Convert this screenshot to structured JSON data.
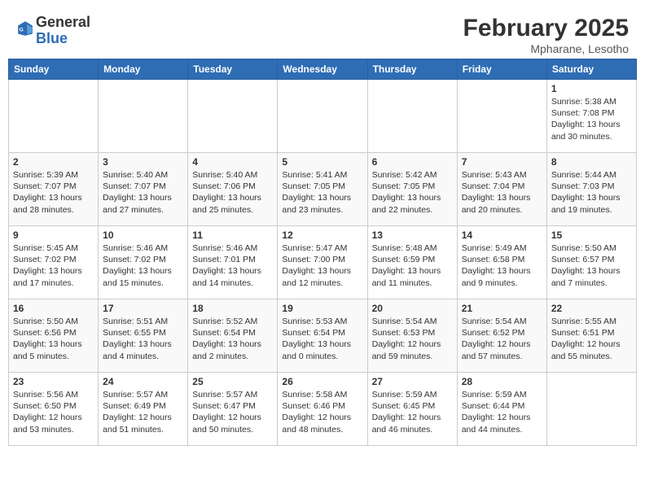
{
  "header": {
    "logo_general": "General",
    "logo_blue": "Blue",
    "month_year": "February 2025",
    "location": "Mpharane, Lesotho"
  },
  "days_of_week": [
    "Sunday",
    "Monday",
    "Tuesday",
    "Wednesday",
    "Thursday",
    "Friday",
    "Saturday"
  ],
  "weeks": [
    [
      {
        "day": "",
        "info": ""
      },
      {
        "day": "",
        "info": ""
      },
      {
        "day": "",
        "info": ""
      },
      {
        "day": "",
        "info": ""
      },
      {
        "day": "",
        "info": ""
      },
      {
        "day": "",
        "info": ""
      },
      {
        "day": "1",
        "info": "Sunrise: 5:38 AM\nSunset: 7:08 PM\nDaylight: 13 hours\nand 30 minutes."
      }
    ],
    [
      {
        "day": "2",
        "info": "Sunrise: 5:39 AM\nSunset: 7:07 PM\nDaylight: 13 hours\nand 28 minutes."
      },
      {
        "day": "3",
        "info": "Sunrise: 5:40 AM\nSunset: 7:07 PM\nDaylight: 13 hours\nand 27 minutes."
      },
      {
        "day": "4",
        "info": "Sunrise: 5:40 AM\nSunset: 7:06 PM\nDaylight: 13 hours\nand 25 minutes."
      },
      {
        "day": "5",
        "info": "Sunrise: 5:41 AM\nSunset: 7:05 PM\nDaylight: 13 hours\nand 23 minutes."
      },
      {
        "day": "6",
        "info": "Sunrise: 5:42 AM\nSunset: 7:05 PM\nDaylight: 13 hours\nand 22 minutes."
      },
      {
        "day": "7",
        "info": "Sunrise: 5:43 AM\nSunset: 7:04 PM\nDaylight: 13 hours\nand 20 minutes."
      },
      {
        "day": "8",
        "info": "Sunrise: 5:44 AM\nSunset: 7:03 PM\nDaylight: 13 hours\nand 19 minutes."
      }
    ],
    [
      {
        "day": "9",
        "info": "Sunrise: 5:45 AM\nSunset: 7:02 PM\nDaylight: 13 hours\nand 17 minutes."
      },
      {
        "day": "10",
        "info": "Sunrise: 5:46 AM\nSunset: 7:02 PM\nDaylight: 13 hours\nand 15 minutes."
      },
      {
        "day": "11",
        "info": "Sunrise: 5:46 AM\nSunset: 7:01 PM\nDaylight: 13 hours\nand 14 minutes."
      },
      {
        "day": "12",
        "info": "Sunrise: 5:47 AM\nSunset: 7:00 PM\nDaylight: 13 hours\nand 12 minutes."
      },
      {
        "day": "13",
        "info": "Sunrise: 5:48 AM\nSunset: 6:59 PM\nDaylight: 13 hours\nand 11 minutes."
      },
      {
        "day": "14",
        "info": "Sunrise: 5:49 AM\nSunset: 6:58 PM\nDaylight: 13 hours\nand 9 minutes."
      },
      {
        "day": "15",
        "info": "Sunrise: 5:50 AM\nSunset: 6:57 PM\nDaylight: 13 hours\nand 7 minutes."
      }
    ],
    [
      {
        "day": "16",
        "info": "Sunrise: 5:50 AM\nSunset: 6:56 PM\nDaylight: 13 hours\nand 5 minutes."
      },
      {
        "day": "17",
        "info": "Sunrise: 5:51 AM\nSunset: 6:55 PM\nDaylight: 13 hours\nand 4 minutes."
      },
      {
        "day": "18",
        "info": "Sunrise: 5:52 AM\nSunset: 6:54 PM\nDaylight: 13 hours\nand 2 minutes."
      },
      {
        "day": "19",
        "info": "Sunrise: 5:53 AM\nSunset: 6:54 PM\nDaylight: 13 hours\nand 0 minutes."
      },
      {
        "day": "20",
        "info": "Sunrise: 5:54 AM\nSunset: 6:53 PM\nDaylight: 12 hours\nand 59 minutes."
      },
      {
        "day": "21",
        "info": "Sunrise: 5:54 AM\nSunset: 6:52 PM\nDaylight: 12 hours\nand 57 minutes."
      },
      {
        "day": "22",
        "info": "Sunrise: 5:55 AM\nSunset: 6:51 PM\nDaylight: 12 hours\nand 55 minutes."
      }
    ],
    [
      {
        "day": "23",
        "info": "Sunrise: 5:56 AM\nSunset: 6:50 PM\nDaylight: 12 hours\nand 53 minutes."
      },
      {
        "day": "24",
        "info": "Sunrise: 5:57 AM\nSunset: 6:49 PM\nDaylight: 12 hours\nand 51 minutes."
      },
      {
        "day": "25",
        "info": "Sunrise: 5:57 AM\nSunset: 6:47 PM\nDaylight: 12 hours\nand 50 minutes."
      },
      {
        "day": "26",
        "info": "Sunrise: 5:58 AM\nSunset: 6:46 PM\nDaylight: 12 hours\nand 48 minutes."
      },
      {
        "day": "27",
        "info": "Sunrise: 5:59 AM\nSunset: 6:45 PM\nDaylight: 12 hours\nand 46 minutes."
      },
      {
        "day": "28",
        "info": "Sunrise: 5:59 AM\nSunset: 6:44 PM\nDaylight: 12 hours\nand 44 minutes."
      },
      {
        "day": "",
        "info": ""
      }
    ]
  ]
}
